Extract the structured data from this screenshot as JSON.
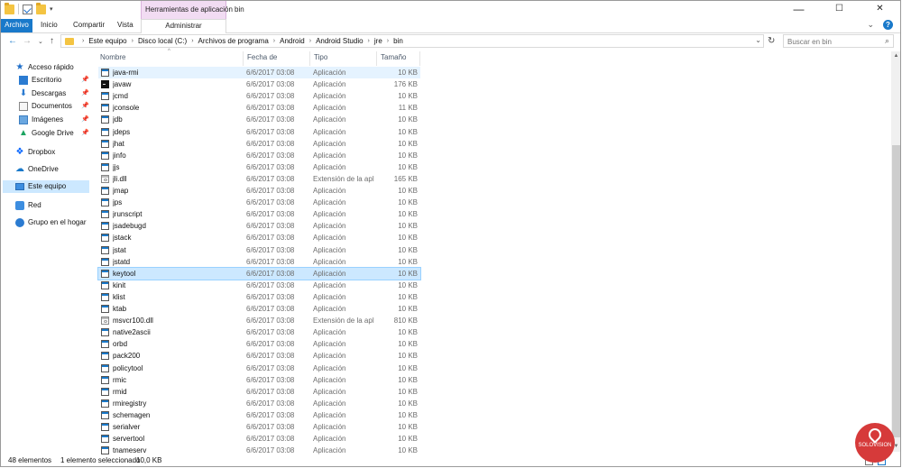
{
  "window": {
    "title": "bin",
    "context_tab_title": "Herramientas de aplicación",
    "controls": [
      "—",
      "☐",
      "✕"
    ]
  },
  "ribbon": {
    "tabs": [
      "Archivo",
      "Inicio",
      "Compartir",
      "Vista",
      "Administrar"
    ]
  },
  "address": {
    "crumbs": [
      "Este equipo",
      "Disco local (C:)",
      "Archivos de programa",
      "Android",
      "Android Studio",
      "jre",
      "bin"
    ]
  },
  "search": {
    "placeholder": "Buscar en bin"
  },
  "nav": {
    "items": [
      {
        "label": "Acceso rápido",
        "icon": "star-icon",
        "pinned": false
      },
      {
        "label": "Escritorio",
        "icon": "desktop-icon",
        "pinned": true
      },
      {
        "label": "Descargas",
        "icon": "download-icon",
        "pinned": true
      },
      {
        "label": "Documentos",
        "icon": "documents-icon",
        "pinned": true
      },
      {
        "label": "Imágenes",
        "icon": "pictures-icon",
        "pinned": true
      },
      {
        "label": "Google Drive",
        "icon": "google-drive-icon",
        "pinned": true
      },
      {
        "label": "Dropbox",
        "icon": "dropbox-icon",
        "pinned": false
      },
      {
        "label": "OneDrive",
        "icon": "onedrive-icon",
        "pinned": false
      },
      {
        "label": "Este equipo",
        "icon": "computer-icon",
        "pinned": false
      },
      {
        "label": "Red",
        "icon": "network-icon",
        "pinned": false
      },
      {
        "label": "Grupo en el hogar",
        "icon": "homegroup-icon",
        "pinned": false
      }
    ]
  },
  "columns": {
    "name": "Nombre",
    "date": "Fecha de modifica...",
    "type": "Tipo",
    "size": "Tamaño"
  },
  "files": [
    {
      "name": "java-rmi",
      "date": "6/6/2017 03:08",
      "type": "Aplicación",
      "size": "10 KB",
      "icon": "app"
    },
    {
      "name": "javaw",
      "date": "6/6/2017 03:08",
      "type": "Aplicación",
      "size": "176 KB",
      "icon": "cmd"
    },
    {
      "name": "jcmd",
      "date": "6/6/2017 03:08",
      "type": "Aplicación",
      "size": "10 KB",
      "icon": "app"
    },
    {
      "name": "jconsole",
      "date": "6/6/2017 03:08",
      "type": "Aplicación",
      "size": "11 KB",
      "icon": "app"
    },
    {
      "name": "jdb",
      "date": "6/6/2017 03:08",
      "type": "Aplicación",
      "size": "10 KB",
      "icon": "app"
    },
    {
      "name": "jdeps",
      "date": "6/6/2017 03:08",
      "type": "Aplicación",
      "size": "10 KB",
      "icon": "app"
    },
    {
      "name": "jhat",
      "date": "6/6/2017 03:08",
      "type": "Aplicación",
      "size": "10 KB",
      "icon": "app"
    },
    {
      "name": "jinfo",
      "date": "6/6/2017 03:08",
      "type": "Aplicación",
      "size": "10 KB",
      "icon": "app"
    },
    {
      "name": "jjs",
      "date": "6/6/2017 03:08",
      "type": "Aplicación",
      "size": "10 KB",
      "icon": "app"
    },
    {
      "name": "jli.dll",
      "date": "6/6/2017 03:08",
      "type": "Extensión de la apl...",
      "size": "165 KB",
      "icon": "dll"
    },
    {
      "name": "jmap",
      "date": "6/6/2017 03:08",
      "type": "Aplicación",
      "size": "10 KB",
      "icon": "app"
    },
    {
      "name": "jps",
      "date": "6/6/2017 03:08",
      "type": "Aplicación",
      "size": "10 KB",
      "icon": "app"
    },
    {
      "name": "jrunscript",
      "date": "6/6/2017 03:08",
      "type": "Aplicación",
      "size": "10 KB",
      "icon": "app"
    },
    {
      "name": "jsadebugd",
      "date": "6/6/2017 03:08",
      "type": "Aplicación",
      "size": "10 KB",
      "icon": "app"
    },
    {
      "name": "jstack",
      "date": "6/6/2017 03:08",
      "type": "Aplicación",
      "size": "10 KB",
      "icon": "app"
    },
    {
      "name": "jstat",
      "date": "6/6/2017 03:08",
      "type": "Aplicación",
      "size": "10 KB",
      "icon": "app"
    },
    {
      "name": "jstatd",
      "date": "6/6/2017 03:08",
      "type": "Aplicación",
      "size": "10 KB",
      "icon": "app"
    },
    {
      "name": "keytool",
      "date": "6/6/2017 03:08",
      "type": "Aplicación",
      "size": "10 KB",
      "icon": "app"
    },
    {
      "name": "kinit",
      "date": "6/6/2017 03:08",
      "type": "Aplicación",
      "size": "10 KB",
      "icon": "app"
    },
    {
      "name": "klist",
      "date": "6/6/2017 03:08",
      "type": "Aplicación",
      "size": "10 KB",
      "icon": "app"
    },
    {
      "name": "ktab",
      "date": "6/6/2017 03:08",
      "type": "Aplicación",
      "size": "10 KB",
      "icon": "app"
    },
    {
      "name": "msvcr100.dll",
      "date": "6/6/2017 03:08",
      "type": "Extensión de la apl...",
      "size": "810 KB",
      "icon": "dll"
    },
    {
      "name": "native2ascii",
      "date": "6/6/2017 03:08",
      "type": "Aplicación",
      "size": "10 KB",
      "icon": "app"
    },
    {
      "name": "orbd",
      "date": "6/6/2017 03:08",
      "type": "Aplicación",
      "size": "10 KB",
      "icon": "app"
    },
    {
      "name": "pack200",
      "date": "6/6/2017 03:08",
      "type": "Aplicación",
      "size": "10 KB",
      "icon": "app"
    },
    {
      "name": "policytool",
      "date": "6/6/2017 03:08",
      "type": "Aplicación",
      "size": "10 KB",
      "icon": "app"
    },
    {
      "name": "rmic",
      "date": "6/6/2017 03:08",
      "type": "Aplicación",
      "size": "10 KB",
      "icon": "app"
    },
    {
      "name": "rmid",
      "date": "6/6/2017 03:08",
      "type": "Aplicación",
      "size": "10 KB",
      "icon": "app"
    },
    {
      "name": "rmiregistry",
      "date": "6/6/2017 03:08",
      "type": "Aplicación",
      "size": "10 KB",
      "icon": "app"
    },
    {
      "name": "schemagen",
      "date": "6/6/2017 03:08",
      "type": "Aplicación",
      "size": "10 KB",
      "icon": "app"
    },
    {
      "name": "serialver",
      "date": "6/6/2017 03:08",
      "type": "Aplicación",
      "size": "10 KB",
      "icon": "app"
    },
    {
      "name": "servertool",
      "date": "6/6/2017 03:08",
      "type": "Aplicación",
      "size": "10 KB",
      "icon": "app"
    },
    {
      "name": "tnameserv",
      "date": "6/6/2017 03:08",
      "type": "Aplicación",
      "size": "10 KB",
      "icon": "app"
    }
  ],
  "hovered_file": "java-rmi",
  "selected_file": "keytool",
  "status": {
    "count": "48 elementos",
    "selection": "1 elemento seleccionado",
    "size": "10,0 KB"
  },
  "logo": {
    "text": "SOLOVISION"
  },
  "colors": {
    "accent": "#1979ca",
    "selected": "#cce8ff",
    "hover": "#e5f3ff",
    "context_tab": "#f2dcf3"
  }
}
